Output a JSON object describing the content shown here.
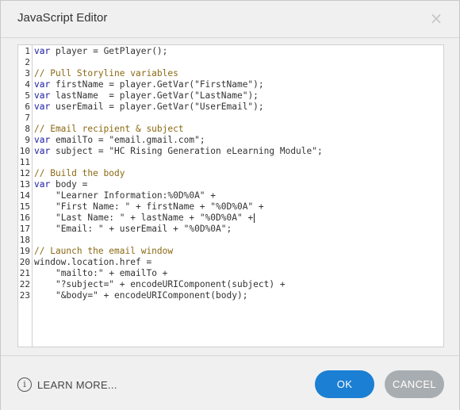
{
  "window": {
    "title": "JavaScript Editor",
    "close_glyph": "×"
  },
  "editor": {
    "lines": [
      {
        "n": "1",
        "tokens": [
          {
            "t": "kw",
            "v": "var"
          },
          {
            "t": "pl",
            "v": " player = GetPlayer();"
          }
        ]
      },
      {
        "n": "2",
        "tokens": []
      },
      {
        "n": "3",
        "tokens": [
          {
            "t": "com",
            "v": "// Pull Storyline variables"
          }
        ]
      },
      {
        "n": "4",
        "tokens": [
          {
            "t": "kw",
            "v": "var"
          },
          {
            "t": "pl",
            "v": " firstName = player.GetVar("
          },
          {
            "t": "str",
            "v": "\"FirstName\""
          },
          {
            "t": "pl",
            "v": ");"
          }
        ]
      },
      {
        "n": "5",
        "tokens": [
          {
            "t": "kw",
            "v": "var"
          },
          {
            "t": "pl",
            "v": " lastName  = player.GetVar("
          },
          {
            "t": "str",
            "v": "\"LastName\""
          },
          {
            "t": "pl",
            "v": ");"
          }
        ]
      },
      {
        "n": "6",
        "tokens": [
          {
            "t": "kw",
            "v": "var"
          },
          {
            "t": "pl",
            "v": " userEmail = player.GetVar("
          },
          {
            "t": "str",
            "v": "\"UserEmail\""
          },
          {
            "t": "pl",
            "v": ");"
          }
        ]
      },
      {
        "n": "7",
        "tokens": []
      },
      {
        "n": "8",
        "tokens": [
          {
            "t": "com",
            "v": "// Email recipient & subject"
          }
        ]
      },
      {
        "n": "9",
        "tokens": [
          {
            "t": "kw",
            "v": "var"
          },
          {
            "t": "pl",
            "v": " emailTo = "
          },
          {
            "t": "str",
            "v": "\"email.gmail.com\""
          },
          {
            "t": "pl",
            "v": ";"
          }
        ]
      },
      {
        "n": "10",
        "tokens": [
          {
            "t": "kw",
            "v": "var"
          },
          {
            "t": "pl",
            "v": " subject = "
          },
          {
            "t": "str",
            "v": "\"HC Rising Generation eLearning Module\""
          },
          {
            "t": "pl",
            "v": ";"
          }
        ]
      },
      {
        "n": "11",
        "tokens": []
      },
      {
        "n": "12",
        "tokens": [
          {
            "t": "com",
            "v": "// Build the body"
          }
        ]
      },
      {
        "n": "13",
        "tokens": [
          {
            "t": "kw",
            "v": "var"
          },
          {
            "t": "pl",
            "v": " body ="
          }
        ]
      },
      {
        "n": "14",
        "tokens": [
          {
            "t": "pl",
            "v": "    "
          },
          {
            "t": "str",
            "v": "\"Learner Information:%0D%0A\""
          },
          {
            "t": "pl",
            "v": " +"
          }
        ]
      },
      {
        "n": "15",
        "tokens": [
          {
            "t": "pl",
            "v": "    "
          },
          {
            "t": "str",
            "v": "\"First Name: \""
          },
          {
            "t": "pl",
            "v": " + firstName + "
          },
          {
            "t": "str",
            "v": "\"%0D%0A\""
          },
          {
            "t": "pl",
            "v": " +"
          }
        ]
      },
      {
        "n": "16",
        "tokens": [
          {
            "t": "pl",
            "v": "    "
          },
          {
            "t": "str",
            "v": "\"Last Name: \""
          },
          {
            "t": "pl",
            "v": " + lastName + "
          },
          {
            "t": "str",
            "v": "\"%0D%0A\""
          },
          {
            "t": "pl",
            "v": " +"
          }
        ],
        "caret": true
      },
      {
        "n": "17",
        "tokens": [
          {
            "t": "pl",
            "v": "    "
          },
          {
            "t": "str",
            "v": "\"Email: \""
          },
          {
            "t": "pl",
            "v": " + userEmail + "
          },
          {
            "t": "str",
            "v": "\"%0D%0A\""
          },
          {
            "t": "pl",
            "v": ";"
          }
        ]
      },
      {
        "n": "18",
        "tokens": []
      },
      {
        "n": "19",
        "tokens": [
          {
            "t": "com",
            "v": "// Launch the email window"
          }
        ]
      },
      {
        "n": "20",
        "tokens": [
          {
            "t": "pl",
            "v": "window.location.href ="
          }
        ]
      },
      {
        "n": "21",
        "tokens": [
          {
            "t": "pl",
            "v": "    "
          },
          {
            "t": "str",
            "v": "\"mailto:\""
          },
          {
            "t": "pl",
            "v": " + emailTo +"
          }
        ]
      },
      {
        "n": "22",
        "tokens": [
          {
            "t": "pl",
            "v": "    "
          },
          {
            "t": "str",
            "v": "\"?subject=\""
          },
          {
            "t": "pl",
            "v": " + encodeURIComponent(subject) +"
          }
        ]
      },
      {
        "n": "23",
        "tokens": [
          {
            "t": "pl",
            "v": "    "
          },
          {
            "t": "str",
            "v": "\"&body=\""
          },
          {
            "t": "pl",
            "v": " + encodeURIComponent(body);"
          }
        ]
      }
    ]
  },
  "footer": {
    "learn_more_label": "LEARN MORE...",
    "info_glyph": "i",
    "ok_label": "OK",
    "cancel_label": "CANCEL"
  },
  "colors": {
    "ok_button": "#1b7fd3",
    "cancel_button": "#a8adb1",
    "keyword": "#1a1aa6",
    "comment": "#8b6914"
  },
  "icons": [
    "close-icon",
    "info-icon"
  ]
}
